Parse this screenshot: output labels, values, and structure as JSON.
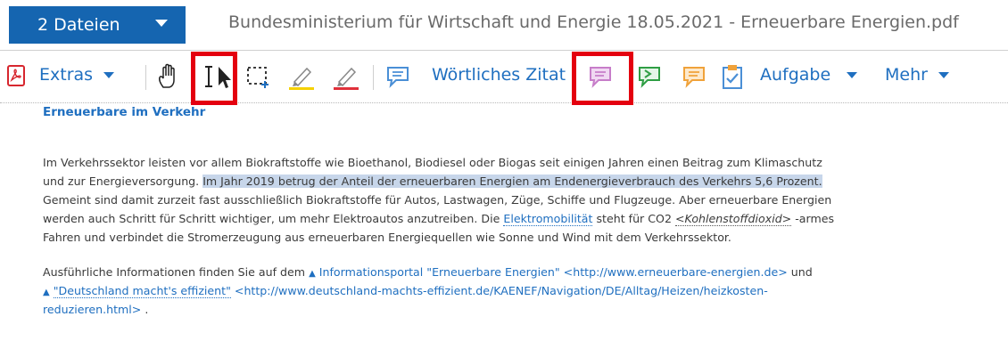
{
  "titlebar": {
    "files_label": "2 Dateien",
    "document_title": "Bundesministerium für Wirtschaft und Energie 18.05.2021 - Erneuerbare Energien.pdf"
  },
  "toolbar": {
    "extras_label": "Extras",
    "quote_label": "Wörtliches Zitat",
    "task_label": "Aufgabe",
    "more_label": "Mehr"
  },
  "content": {
    "heading": "Erneuerbare im Verkehr",
    "p1_l1": "Im Verkehrssektor leisten vor allem Biokraftstoffe wie Bioethanol, Biodiesel oder Biogas seit einigen Jahren einen Beitrag zum Klimaschutz",
    "p1_l2_a": "und zur Energieversorgung. ",
    "p1_l2_hl": "Im Jahr 2019 betrug der Anteil der erneuerbaren Energien am Endenergieverbrauch des Verkehrs 5,6 Prozent.",
    "p1_l3": "Gemeint sind damit zurzeit fast ausschließlich Biokraftstoffe für Autos, Lastwagen, Züge, Schiffe und Flugzeuge. Aber erneuerbare Energien",
    "p1_l4_a": "werden auch Schritt für Schritt wichtiger, um mehr Elektroautos anzutreiben. Die ",
    "p1_l4_link": "Elektromobilität",
    "p1_l4_b": " steht für CO2 ",
    "p1_l4_it": "<Kohlenstoffdioxid>",
    "p1_l4_c": " -armes",
    "p1_l5": "Fahren und verbindet die Stromerzeugung aus erneuerbaren Energiequellen wie Sonne und Wind mit dem Verkehrssektor.",
    "p2_l1_a": "Ausführliche Informationen finden Sie auf dem ",
    "p2_l1_link": "Informationsportal \"Erneuerbare Energien\"",
    "p2_l1_url": " <http://www.erneuerbare-energien.de>",
    "p2_l1_b": " und",
    "p2_l2_link": "\"Deutschland macht's effizient\"",
    "p2_l2_url": " <http://www.deutschland-machts-effizient.de/KAENEF/Navigation/DE/Alltag/Heizen/heizkosten-",
    "p2_l3_url": "reduzieren.html>",
    "p2_l3_b": " ."
  },
  "colors": {
    "accent": "#1565b0",
    "link": "#1f6fc0",
    "highlight": "#c7d6ea",
    "annotation_box": "#e4000f",
    "comment_purple": "#c77dc9",
    "comment_green": "#2f9e44",
    "comment_orange": "#f0a23a",
    "comment_blue": "#4a8fd6"
  },
  "icons": [
    "pdf-icon",
    "hand-tool-icon",
    "text-select-icon",
    "marquee-select-icon",
    "yellow-highlighter-icon",
    "red-highlighter-icon",
    "blue-comment-icon",
    "purple-comment-icon",
    "green-comment-icon",
    "orange-comment-icon",
    "task-clipboard-icon"
  ]
}
